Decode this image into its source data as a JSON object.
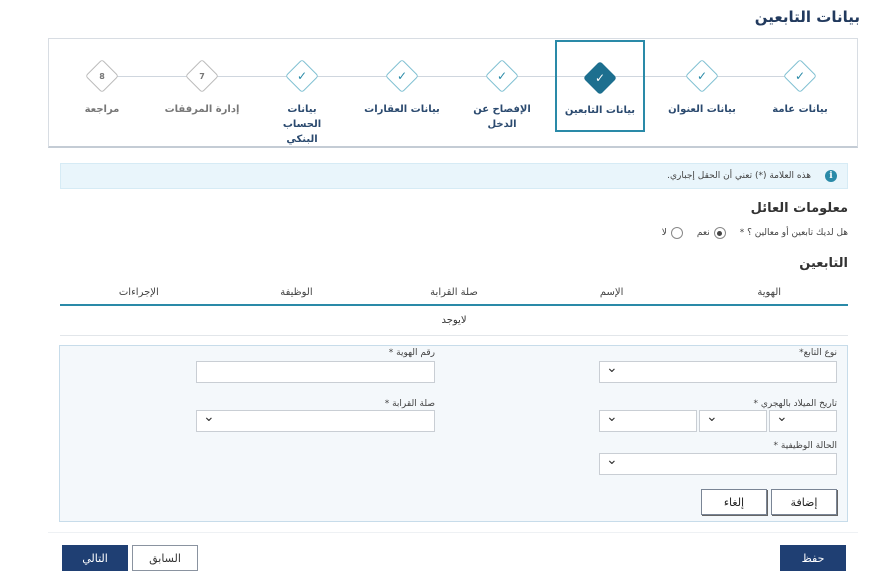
{
  "page": {
    "title": "بيانات التابعين"
  },
  "steps": [
    {
      "label": "بيانات عامة",
      "state": "done",
      "glyph": "✓"
    },
    {
      "label": "بيانات العنوان",
      "state": "done",
      "glyph": "✓"
    },
    {
      "label": "بيانات التابعين",
      "state": "active",
      "glyph": "✓"
    },
    {
      "label": "الإفصاح عن الدخل",
      "state": "done",
      "glyph": "✓"
    },
    {
      "label": "بيانات العقارات",
      "state": "done",
      "glyph": "✓"
    },
    {
      "label": "بيانات الحساب البنكي",
      "state": "done",
      "glyph": "✓"
    },
    {
      "label": "إدارة المرفقات",
      "state": "pending",
      "glyph": "7"
    },
    {
      "label": "مراجعة",
      "state": "pending",
      "glyph": "8"
    }
  ],
  "info": {
    "icon": "i",
    "text": "هذه العلامة (*) تعني أن الحقل إجباري."
  },
  "family": {
    "title": "معلومات العائل",
    "question": "هل لديك تابعين أو معالين ؟ *",
    "yes": "نعم",
    "no": "لا"
  },
  "dependents": {
    "title": "التابعين",
    "columns": [
      "الهوية",
      "الإسم",
      "صلة القرابة",
      "الوظيفة",
      "الإجراءات"
    ],
    "empty": "لايوجد"
  },
  "form": {
    "dep_type": "نوع التابع*",
    "id_number": "رقم الهوية *",
    "hijri_birth": "تاريخ الميلاد بالهجري *",
    "relation": "صلة القرابة *",
    "job_status": "الحالة الوظيفية *",
    "add": "إضافة",
    "cancel": "إلغاء"
  },
  "actions": {
    "save": "حفظ",
    "prev": "السابق",
    "next": "التالي"
  }
}
